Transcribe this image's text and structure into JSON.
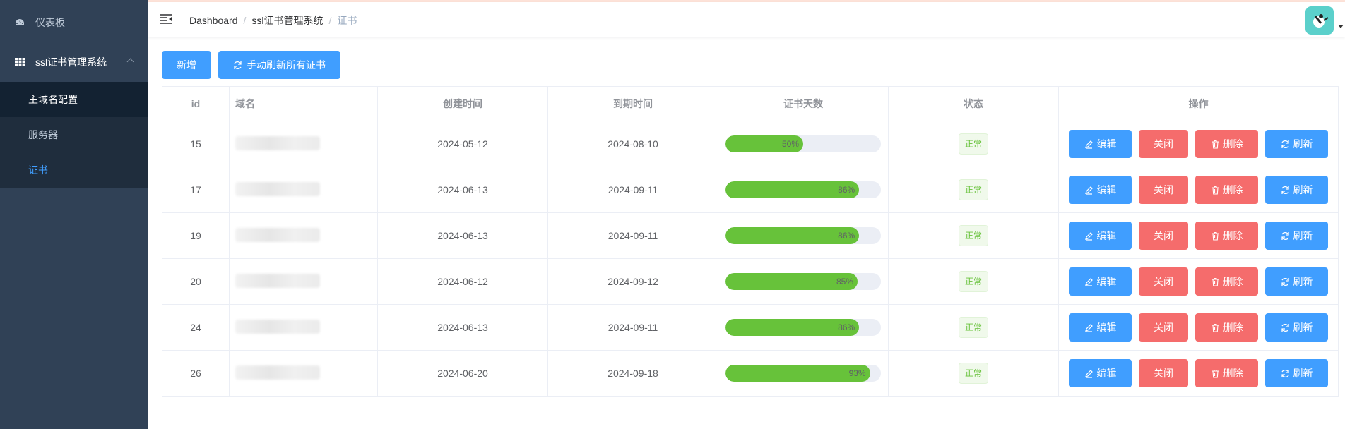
{
  "sidebar": {
    "items": [
      {
        "label": "仪表板",
        "icon": "dashboard-icon"
      },
      {
        "label": "ssl证书管理系统",
        "icon": "table-icon"
      }
    ],
    "subitems": [
      {
        "label": "主域名配置"
      },
      {
        "label": "服务器"
      },
      {
        "label": "证书",
        "active": true
      }
    ]
  },
  "breadcrumb": {
    "items": [
      "Dashboard",
      "ssl证书管理系统"
    ],
    "current": "证书"
  },
  "toolbar": {
    "add_label": "新增",
    "refresh_all_label": "手动刷新所有证书"
  },
  "table": {
    "headers": [
      "id",
      "域名",
      "创建时间",
      "到期时间",
      "证书天数",
      "状态",
      "操作"
    ],
    "rows": [
      {
        "id": "15",
        "created": "2024-05-12",
        "expires": "2024-08-10",
        "progress": "50%",
        "status": "正常"
      },
      {
        "id": "17",
        "created": "2024-06-13",
        "expires": "2024-09-11",
        "progress": "86%",
        "status": "正常"
      },
      {
        "id": "19",
        "created": "2024-06-13",
        "expires": "2024-09-11",
        "progress": "86%",
        "status": "正常"
      },
      {
        "id": "20",
        "created": "2024-06-12",
        "expires": "2024-09-12",
        "progress": "85%",
        "status": "正常"
      },
      {
        "id": "24",
        "created": "2024-06-13",
        "expires": "2024-09-11",
        "progress": "86%",
        "status": "正常"
      },
      {
        "id": "26",
        "created": "2024-06-20",
        "expires": "2024-09-18",
        "progress": "93%",
        "status": "正常"
      }
    ],
    "actions": {
      "edit": "编辑",
      "close": "关闭",
      "delete": "删除",
      "refresh": "刷新"
    }
  },
  "colors": {
    "primary": "#409eff",
    "danger": "#f56c6c",
    "success": "#67c23a",
    "sidebar": "#304156"
  }
}
